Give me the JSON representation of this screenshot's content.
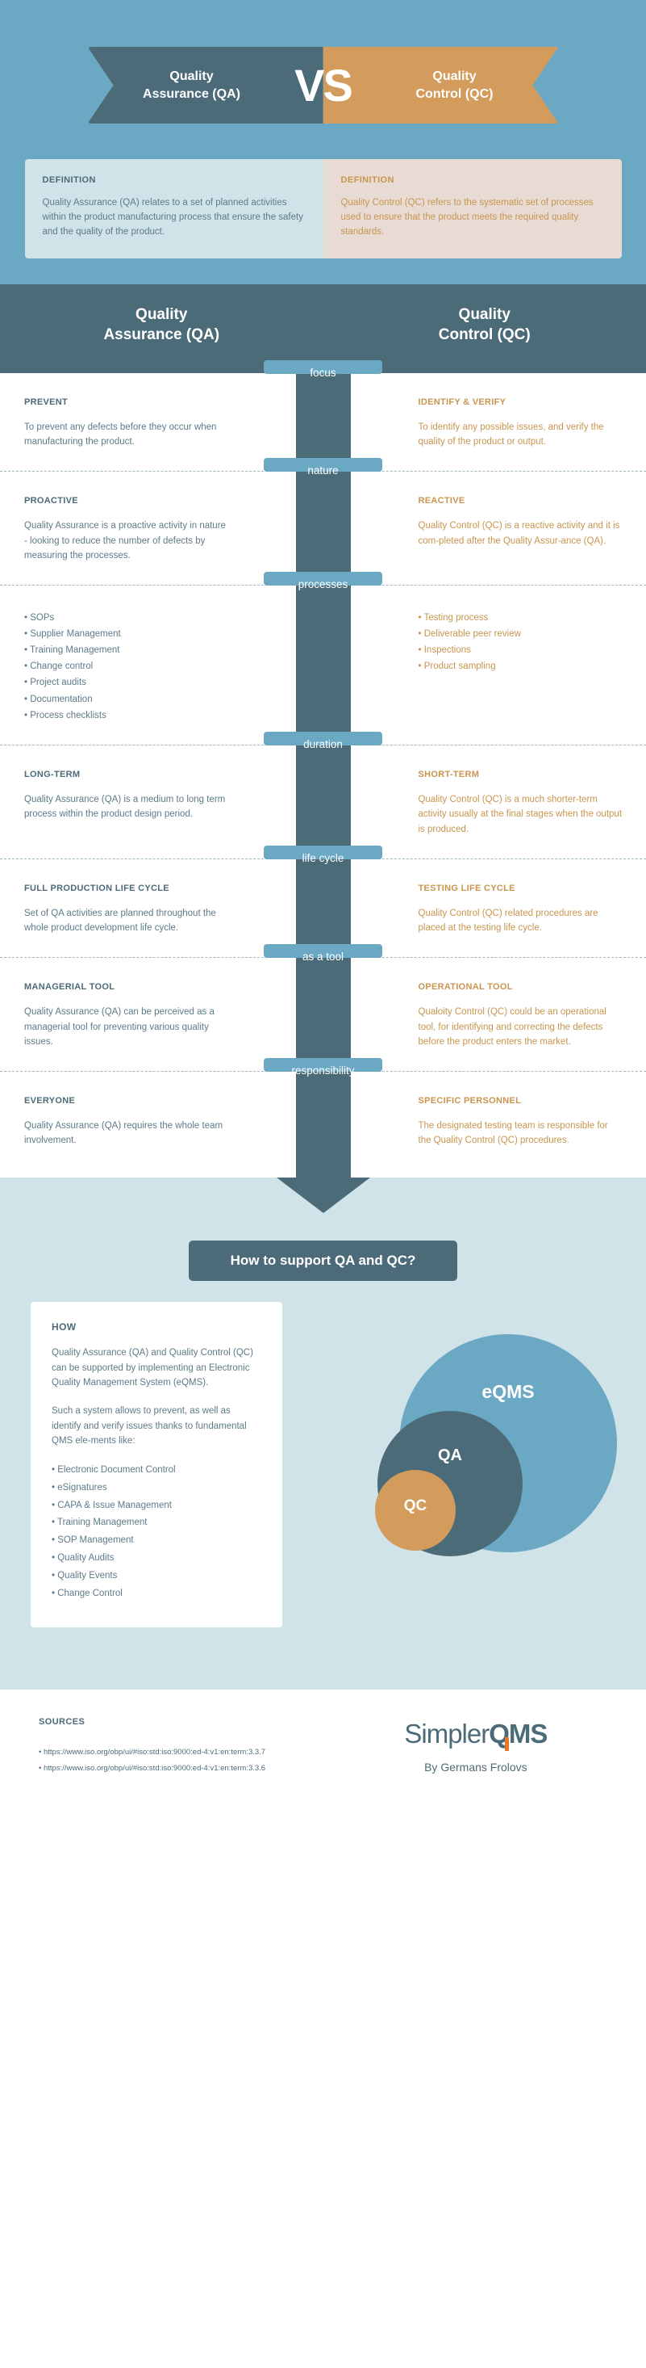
{
  "banner": {
    "left_title": "Quality\nAssurance (QA)",
    "left_line1": "Quality",
    "left_line2": "Assurance (QA)",
    "vs": "VS",
    "right_line1": "Quality",
    "right_line2": "Control (QC)"
  },
  "definitions": {
    "qa": {
      "label": "DEFINITION",
      "text": "Quality Assurance (QA) relates to a set of planned activities within the product manufacturing process that ensure the safety and the quality of the product."
    },
    "qc": {
      "label": "DEFINITION",
      "text": "Quality Control (QC) refers to the systematic set of processes used to ensure that the product meets the required quality standards."
    }
  },
  "comparison": {
    "header_left_line1": "Quality",
    "header_left_line2": "Assurance (QA)",
    "header_right_line1": "Quality",
    "header_right_line2": "Control (QC)",
    "rows": [
      {
        "pill": "focus",
        "left_title": "PREVENT",
        "left_body": "To prevent any defects before they occur when manufacturing the product.",
        "right_title": "IDENTIFY & VERIFY",
        "right_body": "To identify any possible issues, and verify the quality of the product or output."
      },
      {
        "pill": "nature",
        "left_title": "PROACTIVE",
        "left_body": "Quality Assurance is a proactive activity in nature - looking to reduce the number of defects by measuring the processes.",
        "right_title": "REACTIVE",
        "right_body": "Quality Control (QC) is a reactive activity and it is com-pleted after the Quality Assur-ance (QA)."
      },
      {
        "pill": "processes",
        "left_list": [
          "SOPs",
          "Supplier Management",
          "Training Management",
          "Change control",
          "Project audits",
          "Documentation",
          "Process checklists"
        ],
        "right_list": [
          "Testing process",
          "Deliverable peer review",
          "Inspections",
          "Product sampling"
        ]
      },
      {
        "pill": "duration",
        "left_title": "LONG-TERM",
        "left_body": "Quality Assurance (QA) is a medium to long term process within the product design period.",
        "right_title": "SHORT-TERM",
        "right_body": "Quality Control (QC) is a much shorter-term activity usually at the final stages when the output is produced."
      },
      {
        "pill": "life cycle",
        "left_title": "FULL PRODUCTION LIFE CYCLE",
        "left_body": "Set of QA activities are planned throughout the whole product development life cycle.",
        "right_title": "TESTING LIFE CYCLE",
        "right_body": "Quality Control (QC) related procedures are placed at the testing life cycle."
      },
      {
        "pill": "as a tool",
        "left_title": "MANAGERIAL TOOL",
        "left_body": "Quality Assurance (QA) can be perceived as a managerial tool for preventing various quality issues.",
        "right_title": "OPERATIONAL TOOL",
        "right_body": "Qualoity Control (QC) could be an operational tool, for identifying and correcting the defects before the product enters the market."
      },
      {
        "pill": "responsibility",
        "left_title": "EVERYONE",
        "left_body": "Quality Assurance (QA) requires the whole team involvement.",
        "right_title": "SPECIFIC PERSONNEL",
        "right_body": "The designated testing team is responsible for the Quality Control (QC) procedures."
      }
    ]
  },
  "support": {
    "button_label": "How to support QA and QC?",
    "how_title": "HOW",
    "how_paragraph_1": "Quality Assurance (QA) and Quality Control (QC) can be supported by implementing an Electronic Quality Management System (eQMS).",
    "how_paragraph_2": "Such a system allows to prevent, as well as identify and verify issues thanks to fundamental QMS ele-ments like:",
    "how_list": [
      "Electronic Document Control",
      "eSignatures",
      "CAPA & Issue Management",
      "Training Management",
      "SOP Management",
      "Quality Audits",
      "Quality Events",
      "Change Control"
    ],
    "venn": {
      "outer_label": "eQMS",
      "middle_label": "QA",
      "inner_label": "QC"
    }
  },
  "footer": {
    "sources_title": "SOURCES",
    "sources": [
      "https://www.iso.org/obp/ui/#iso:std:iso:9000:ed-4:v1:en:term:3.3.7",
      "https://www.iso.org/obp/ui/#iso:std:iso:9000:ed-4:v1:en:term:3.3.6"
    ],
    "logo_light": "Simpler",
    "logo_bold": "QMS",
    "byline": "By Germans Frolovs"
  },
  "colors": {
    "blue_bg": "#6ba8c4",
    "dark_slate": "#4c6b78",
    "orange": "#d39b5c",
    "light_blue_bg": "#cfe3e8",
    "def_qc_bg": "#e8dbd4",
    "logo_accent": "#e87722"
  }
}
